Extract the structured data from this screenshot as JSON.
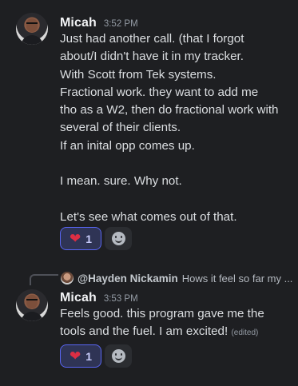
{
  "messages": [
    {
      "username": "Micah",
      "timestamp": "3:52 PM",
      "lines": [
        "Just had another call. (that I forgot",
        "about/I didn't have it in my tracker.",
        "With Scott from Tek systems.",
        "Fractional work. they want to add me",
        "tho as a W2, then do fractional work with",
        "several of their clients.",
        "If an inital opp comes up.",
        "",
        "I mean. sure. Why not.",
        "",
        "Let's see what comes out of that."
      ],
      "reaction": {
        "emoji": "heart",
        "count": "1"
      }
    },
    {
      "reply_to": {
        "mention": "@Hayden Nickamin",
        "preview": "Hows it feel so far my ..."
      },
      "username": "Micah",
      "timestamp": "3:53 PM",
      "lines": [
        "Feels good. this program gave me the",
        "tools and the fuel. I am excited!"
      ],
      "edited_label": "(edited)",
      "reaction": {
        "emoji": "heart",
        "count": "1"
      }
    }
  ],
  "colors": {
    "background": "#1e1f22",
    "reaction_border": "#5865f2",
    "heart": "#dd2e44"
  }
}
